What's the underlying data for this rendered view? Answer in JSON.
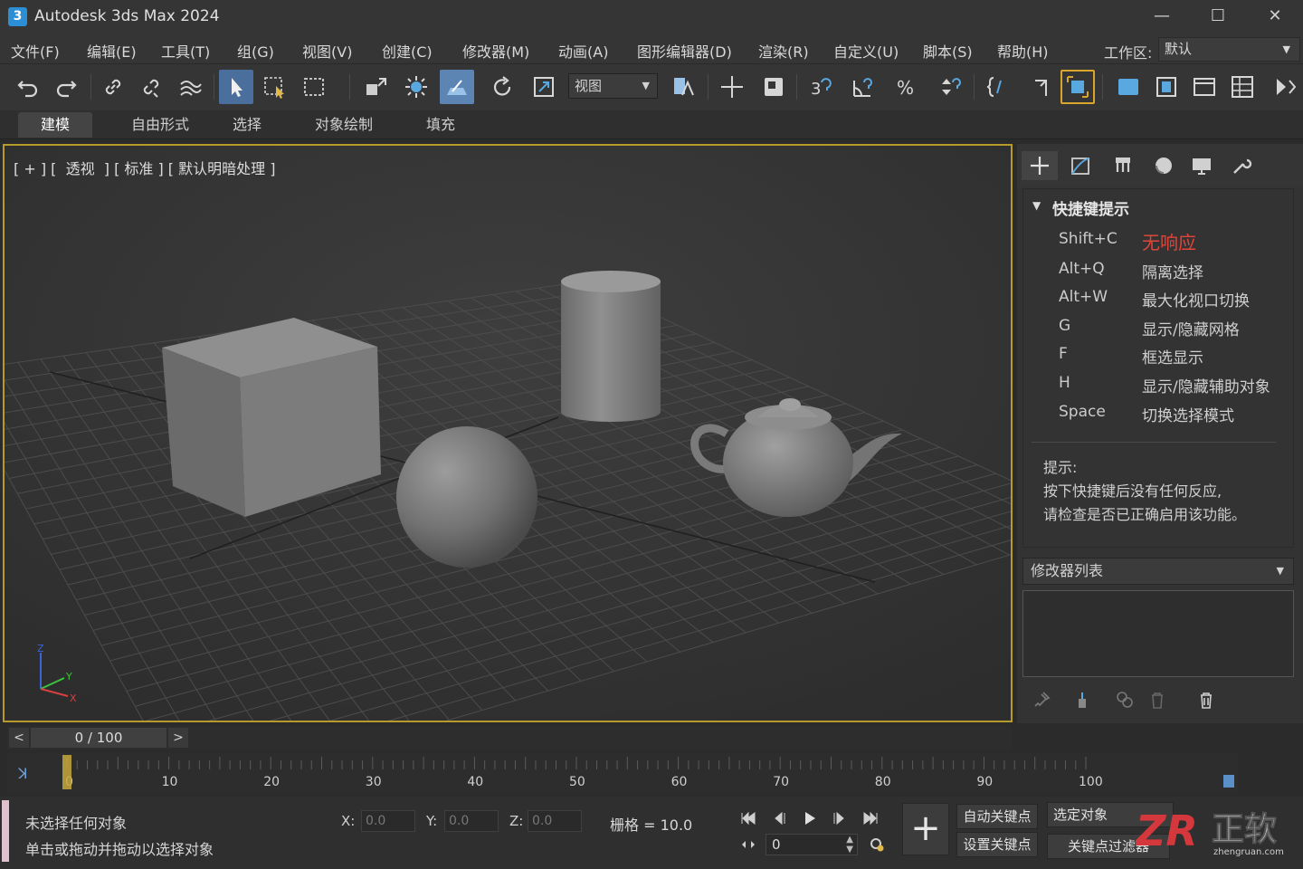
{
  "window": {
    "title": "Autodesk 3ds Max 2024",
    "icon_text": "3",
    "minimize": "—",
    "maximize": "☐",
    "close": "✕"
  },
  "menu": [
    "文件(F)",
    "编辑(E)",
    "工具(T)",
    "组(G)",
    "视图(V)",
    "创建(C)",
    "修改器(M)",
    "动画(A)",
    "图形编辑器(D)",
    "渲染(R)",
    "自定义(U)",
    "脚本(S)",
    "帮助(H)"
  ],
  "workspace": {
    "label": "工作区:",
    "value": "默认"
  },
  "toolbar": {
    "view_select": "视图"
  },
  "ribbon_tabs": [
    "建模",
    "自由形式",
    "选择",
    "对象绘制",
    "填充"
  ],
  "viewport": {
    "label": "[ + ] [  透视  ] [ 标准 ] [ 默认明暗处理 ]",
    "axis": {
      "z": "Z",
      "y": "Y",
      "x": "X"
    }
  },
  "hint_panel": {
    "title": "快捷键提示",
    "shortcuts": [
      {
        "key": "Shift+C",
        "action": "无响应",
        "highlight": true
      },
      {
        "key": "Alt+Q",
        "action": "隔离选择"
      },
      {
        "key": "Alt+W",
        "action": "最大化视口切换"
      },
      {
        "key": "G",
        "action": "显示/隐藏网格"
      },
      {
        "key": "F",
        "action": "框选显示"
      },
      {
        "key": "H",
        "action": "显示/隐藏辅助对象"
      },
      {
        "key": "Space",
        "action": "切换选择模式"
      }
    ],
    "tip_title": "提示:",
    "tip_lines": [
      "按下快捷键后没有任何反应,",
      "请检查是否已正确启用该功能。"
    ]
  },
  "modifier": {
    "label": "修改器列表"
  },
  "time_slider": {
    "value": "0 / 100",
    "prev": "<",
    "next": ">"
  },
  "trackbar": {
    "ticks": [
      "0",
      "10",
      "20",
      "30",
      "40",
      "50",
      "60",
      "70",
      "80",
      "90",
      "100"
    ]
  },
  "status": {
    "line1": "未选择任何对象",
    "line2": "单击或拖动并拖动以选择对象",
    "x_label": "X:",
    "x_value": "0.0",
    "y_label": "Y:",
    "y_value": "0.0",
    "z_label": "Z:",
    "z_value": "0.0",
    "grid": "栅格 = 10.0"
  },
  "anim": {
    "frame": "0",
    "auto_key": "自动关键点",
    "selected": "选定对象",
    "set_key": "设置关键点",
    "key_filter": "关键点过滤器",
    "add": "+"
  },
  "watermark": {
    "text": "正软",
    "url": "zhengruan.com"
  },
  "colors": {
    "accent": "#4a6f9c",
    "viewport_border": "#b69a2a",
    "warning": "#e0453a"
  }
}
